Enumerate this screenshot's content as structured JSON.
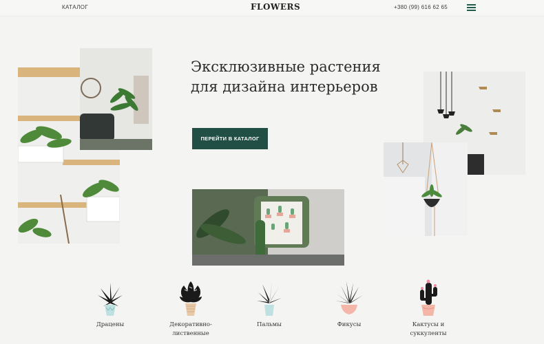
{
  "header": {
    "catalog_link": "КАТАЛОГ",
    "logo": "FLOWERS",
    "phone": "+380 (99) 616 62 65"
  },
  "hero": {
    "title": "Эксклюзивные растения для дизайна интерьеров",
    "cta_label": "ПЕРЕЙТИ В КАТАЛОГ"
  },
  "categories": [
    {
      "label": "Драцены",
      "icon": "dracaena-icon"
    },
    {
      "label": "Декоративно-лиственные",
      "icon": "decorative-plant-icon"
    },
    {
      "label": "Пальмы",
      "icon": "palm-icon"
    },
    {
      "label": "Фикусы",
      "icon": "ficus-icon"
    },
    {
      "label": "Кактусы и суккуленты",
      "icon": "cactus-icon"
    }
  ],
  "colors": {
    "accent": "#214e45",
    "background": "#f4f4f3",
    "pot_pink": "#f3b6a8",
    "pot_blue": "#bfe0e0"
  }
}
